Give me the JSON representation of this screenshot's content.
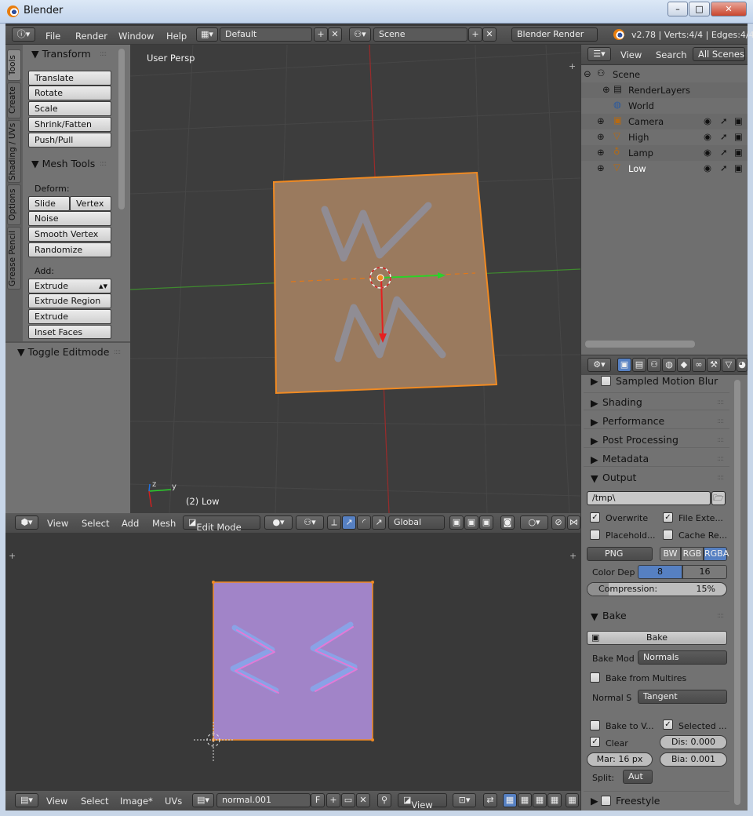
{
  "window": {
    "title": "Blender",
    "min": "0",
    "max": "1",
    "close": "r"
  },
  "info_bar": {
    "menus": [
      "File",
      "Render",
      "Window",
      "Help"
    ],
    "layout": "Default",
    "scene": "Scene",
    "engine": "Blender Render",
    "stats": "v2.78 | Verts:4/4 | Edges:4/4"
  },
  "tool_shelf": {
    "tabs": [
      "Tools",
      "Create",
      "Shading / UVs",
      "Options",
      "Grease Pencil"
    ],
    "transform": {
      "title": "Transform",
      "buttons": [
        "Translate",
        "Rotate",
        "Scale",
        "Shrink/Fatten",
        "Push/Pull"
      ]
    },
    "mesh_tools": {
      "title": "Mesh Tools",
      "deform_label": "Deform:",
      "slide_edge": "Slide Ed",
      "vertex": "Vertex",
      "buttons": [
        "Noise",
        "Smooth Vertex",
        "Randomize"
      ],
      "add_label": "Add:",
      "extrude": "Extrude",
      "add_buttons": [
        "Extrude Region",
        "Extrude Individual",
        "Inset Faces"
      ]
    },
    "toggle": "Toggle Editmode"
  },
  "viewport": {
    "persp": "User Persp",
    "object": "(2) Low",
    "axis_x": "y",
    "axis_z": "z"
  },
  "viewport_header": {
    "menus": [
      "View",
      "Select",
      "Add",
      "Mesh"
    ],
    "mode": "Edit Mode",
    "orientation": "Global"
  },
  "uv_header": {
    "menus": [
      "View",
      "Select",
      "Image*",
      "UVs"
    ],
    "image": "normal.001",
    "fake": "F",
    "view": "View"
  },
  "outliner": {
    "menus": [
      "View",
      "Search"
    ],
    "filter": "All Scenes",
    "rows": [
      {
        "label": "Scene"
      },
      {
        "label": "RenderLayers"
      },
      {
        "label": "World"
      },
      {
        "label": "Camera"
      },
      {
        "label": "High"
      },
      {
        "label": "Lamp"
      },
      {
        "label": "Low"
      }
    ]
  },
  "properties": {
    "sampled_motion_blur": "Sampled Motion Blur",
    "panels": [
      "Shading",
      "Performance",
      "Post Processing",
      "Metadata"
    ],
    "output": {
      "title": "Output",
      "path": "/tmp\\",
      "overwrite": "Overwrite",
      "file_ext": "File Exte...",
      "placeholders": "Placehold...",
      "cache": "Cache Re...",
      "format": "PNG",
      "bw": "BW",
      "rgb": "RGB",
      "rgba": "RGBA",
      "color_depth_label": "Color Dep",
      "depth_8": "8",
      "depth_16": "16",
      "compression": "Compression:",
      "compression_value": "15%",
      "compression_fraction": 0.15
    },
    "bake": {
      "title": "Bake",
      "button": "Bake",
      "mode_label": "Bake Mod",
      "mode": "Normals",
      "from_multires": "Bake from Multires",
      "normal_space_label": "Normal S",
      "normal_space": "Tangent",
      "bake_to_vertex": "Bake to V...",
      "selected_to_active": "Selected ...",
      "clear": "Clear",
      "distance": "Dis: 0.000",
      "margin": "Mar: 16 px",
      "bias": "Bia: 0.001",
      "split_label": "Split:",
      "split": "Aut"
    },
    "freestyle": "Freestyle"
  }
}
